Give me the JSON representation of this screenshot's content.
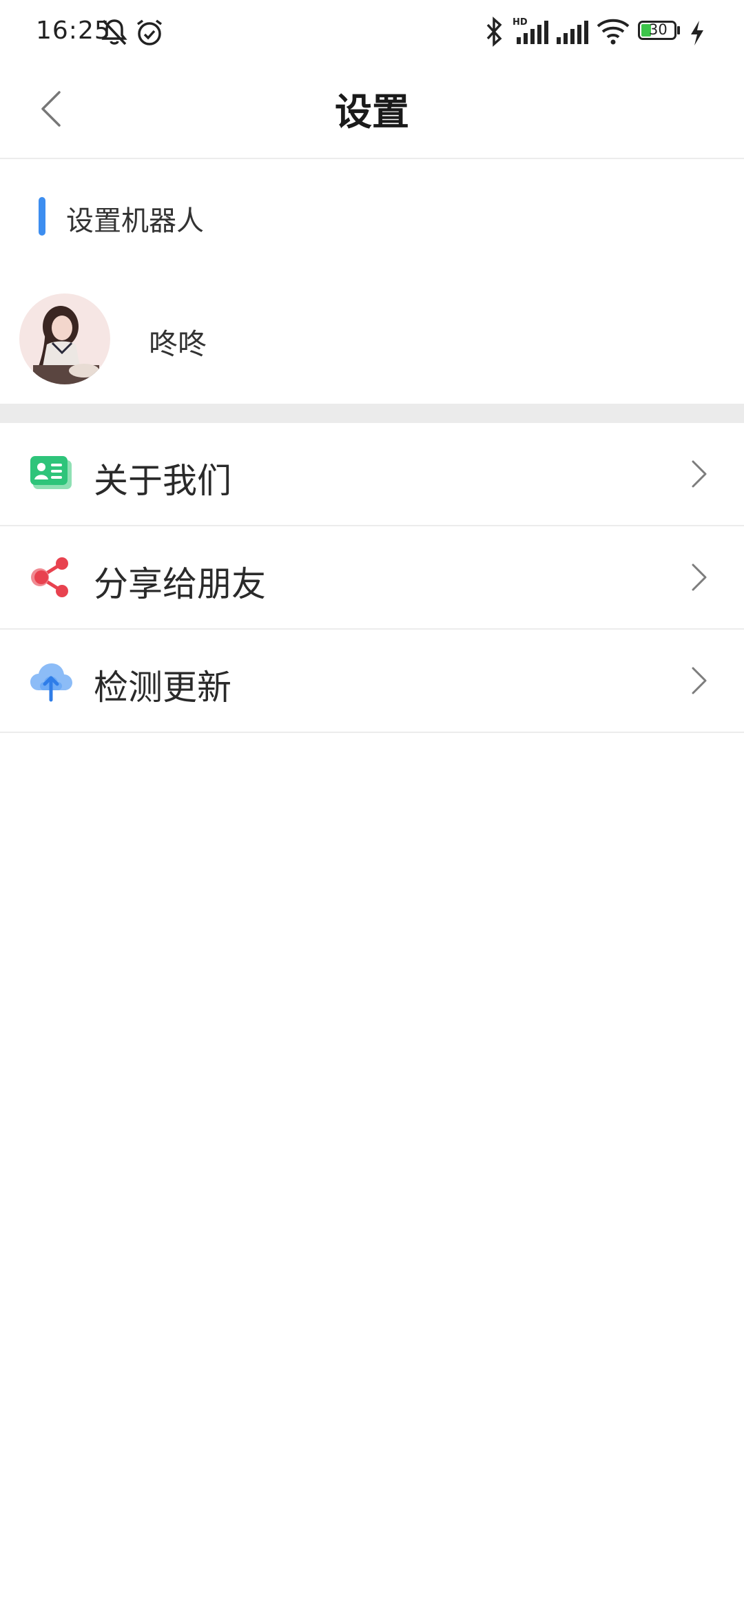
{
  "status_bar": {
    "time": "16:25",
    "battery": "30",
    "icons": [
      "mute-bell-icon",
      "alarm-icon",
      "bluetooth-icon",
      "signal-hd-icon",
      "signal-icon",
      "wifi-icon",
      "battery-icon",
      "charging-icon"
    ]
  },
  "header": {
    "title": "设置",
    "back_icon": "chevron-left-icon"
  },
  "robot_section": {
    "title": "设置机器人",
    "accent": "#3d8ef0",
    "robot_name": "咚咚"
  },
  "menu": {
    "items": [
      {
        "label": "关于我们",
        "icon": "contact-card-icon",
        "color": "#2ec47a"
      },
      {
        "label": "分享给朋友",
        "icon": "share-icon",
        "color": "#e8424f"
      },
      {
        "label": "检测更新",
        "icon": "cloud-upload-icon",
        "color": "#5aa0f5"
      }
    ]
  }
}
